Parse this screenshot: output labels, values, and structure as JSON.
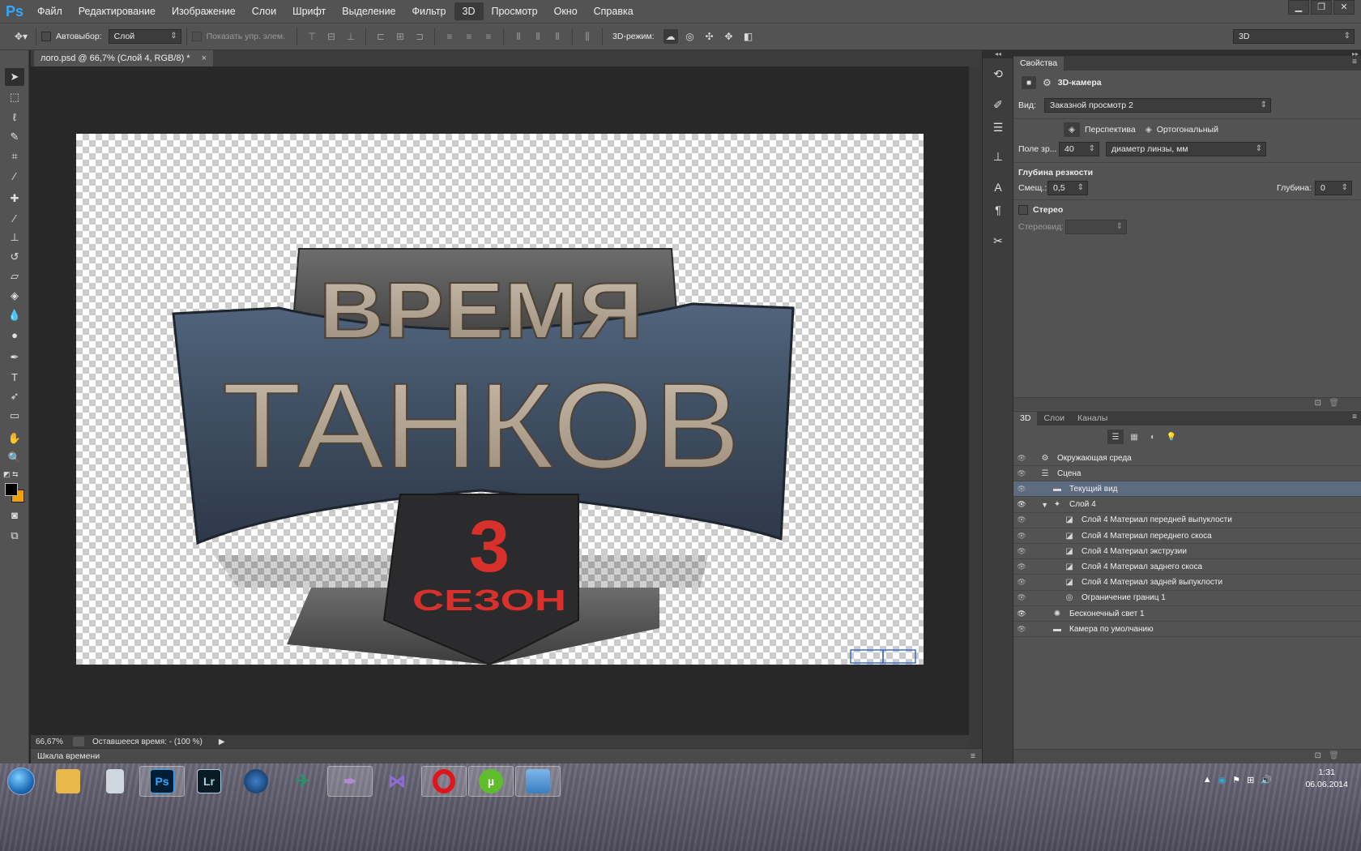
{
  "app": {
    "logo": "Ps"
  },
  "menu": [
    "Файл",
    "Редактирование",
    "Изображение",
    "Слои",
    "Шрифт",
    "Выделение",
    "Фильтр",
    "3D",
    "Просмотр",
    "Окно",
    "Справка"
  ],
  "menu_active": "3D",
  "options": {
    "autoselect_label": "Автовыбор:",
    "autoselect_value": "Слой",
    "show_controls_label": "Показать упр. элем.",
    "mode3d_label": "3D-режим:",
    "workspace_value": "3D"
  },
  "document": {
    "tab_title": "лого.psd @ 66,7% (Слой 4, RGB/8) *",
    "close": "×"
  },
  "artwork": {
    "line1": "ВРЕМЯ",
    "line2": "ТАНКОВ",
    "number": "3",
    "line3": "СЕЗОН",
    "colors": {
      "metal": "#b3a494",
      "red": "#d8302a",
      "steel": "#46556a",
      "dark": "#2e2e30"
    }
  },
  "status": {
    "zoom": "66,67%",
    "info": "Оставшееся время: - (100 %)"
  },
  "timeline_label": "Шкала времени",
  "properties": {
    "tab": "Свойства",
    "header": "3D-камера",
    "view_label": "Вид:",
    "view_value": "Заказной просмотр 2",
    "perspective": "Перспектива",
    "orthographic": "Ортогональный",
    "fov_label": "Поле зр...",
    "fov_value": "40",
    "fov_unit": "диаметр линзы, мм",
    "dof_title": "Глубина резкости",
    "offset_label": "Смещ.:",
    "offset_value": "0,5",
    "depth_label": "Глубина:",
    "depth_value": "0",
    "stereo_label": "Стерео",
    "stereo_view_label": "Стереовид:"
  },
  "layers_panel": {
    "tabs": [
      "3D",
      "Слои",
      "Каналы"
    ],
    "active_tab": "3D",
    "rows": [
      {
        "label": "Окружающая среда",
        "indent": 0,
        "icon": "environment-icon",
        "visible": false,
        "selected": false
      },
      {
        "label": "Сцена",
        "indent": 0,
        "icon": "scene-icon",
        "visible": false,
        "selected": false
      },
      {
        "label": "Текущий вид",
        "indent": 1,
        "icon": "camera-icon",
        "visible": false,
        "selected": true
      },
      {
        "label": "Слой 4",
        "indent": 1,
        "icon": "mesh-icon",
        "visible": true,
        "selected": false
      },
      {
        "label": "Слой 4 Материал передней выпуклости",
        "indent": 2,
        "icon": "material-icon",
        "visible": false,
        "selected": false
      },
      {
        "label": "Слой 4 Материал переднего скоса",
        "indent": 2,
        "icon": "material-icon",
        "visible": false,
        "selected": false
      },
      {
        "label": "Слой 4 Материал экструзии",
        "indent": 2,
        "icon": "material-icon",
        "visible": false,
        "selected": false
      },
      {
        "label": "Слой 4 Материал заднего скоса",
        "indent": 2,
        "icon": "material-icon",
        "visible": false,
        "selected": false
      },
      {
        "label": "Слой 4 Материал задней выпуклости",
        "indent": 2,
        "icon": "material-icon",
        "visible": false,
        "selected": false
      },
      {
        "label": "Ограничение границ 1",
        "indent": 2,
        "icon": "bounds-icon",
        "visible": false,
        "selected": false
      },
      {
        "label": "Бесконечный свет 1",
        "indent": 1,
        "icon": "light-icon",
        "visible": true,
        "selected": false
      },
      {
        "label": "Камера по умолчанию",
        "indent": 1,
        "icon": "camera-icon",
        "visible": false,
        "selected": false
      }
    ]
  },
  "taskbar": {
    "apps": [
      {
        "name": "start-button",
        "label": ""
      },
      {
        "name": "explorer",
        "label": ""
      },
      {
        "name": "calculator",
        "label": ""
      },
      {
        "name": "photoshop",
        "label": "Ps"
      },
      {
        "name": "lightroom",
        "label": "Lr"
      },
      {
        "name": "cinema4d",
        "label": ""
      },
      {
        "name": "plane-app",
        "label": ""
      },
      {
        "name": "feather-app",
        "label": ""
      },
      {
        "name": "visual-studio",
        "label": ""
      },
      {
        "name": "opera",
        "label": ""
      },
      {
        "name": "utorrent",
        "label": ""
      },
      {
        "name": "photo-viewer",
        "label": ""
      }
    ],
    "time": "1:31",
    "date": "06.06.2014"
  }
}
